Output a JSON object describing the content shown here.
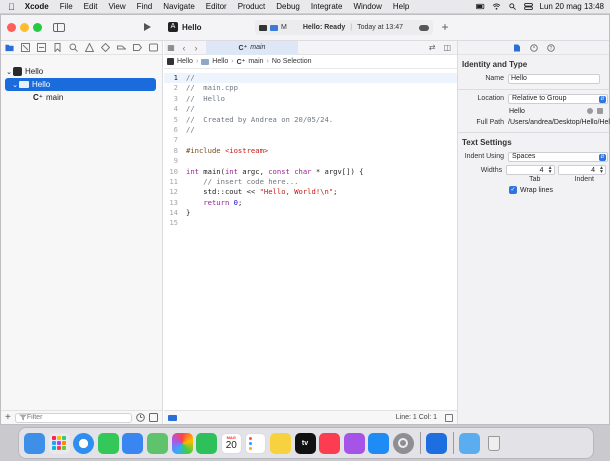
{
  "menubar": {
    "items": [
      "Xcode",
      "File",
      "Edit",
      "View",
      "Find",
      "Navigate",
      "Editor",
      "Product",
      "Debug",
      "Integrate",
      "Window",
      "Help"
    ],
    "clock": "Lun 20 mag  13:48"
  },
  "toolbar": {
    "project_title": "Hello",
    "status_device": "M",
    "status_text_bold": "Hello: Ready",
    "status_text_sep": "|",
    "status_time": "Today at 13:47"
  },
  "navigator": {
    "tree": {
      "project": "Hello",
      "group": "Hello",
      "file": "main",
      "file_prefix": "C⁺"
    },
    "filter_placeholder": "Filter"
  },
  "editor": {
    "tab": {
      "prefix": "C⁺",
      "label": "main"
    },
    "jumpbar": {
      "project": "Hello",
      "group": "Hello",
      "file_prefix": "C⁺",
      "file": "main",
      "selection": "No Selection"
    },
    "lines": [
      {
        "n": "1",
        "text": "//"
      },
      {
        "n": "2",
        "text": "//  main.cpp"
      },
      {
        "n": "3",
        "text": "//  Hello"
      },
      {
        "n": "4",
        "text": "//"
      },
      {
        "n": "5",
        "text": "//  Created by Andrea on 20/05/24."
      },
      {
        "n": "6",
        "text": "//"
      },
      {
        "n": "7",
        "text": ""
      },
      {
        "n": "8",
        "text": "#include <iostream>"
      },
      {
        "n": "9",
        "text": ""
      },
      {
        "n": "10",
        "text": "int main(int argc, const char * argv[]) {"
      },
      {
        "n": "11",
        "text": "    // insert code here..."
      },
      {
        "n": "12",
        "text": "    std::cout << \"Hello, World!\\n\";"
      },
      {
        "n": "13",
        "text": "    return 0;"
      },
      {
        "n": "14",
        "text": "}"
      },
      {
        "n": "15",
        "text": ""
      }
    ],
    "code_tokens": {
      "l8_directive": "#include ",
      "l8_header": "<iostream>",
      "l10_kw1": "int",
      "l10_t1": " main(",
      "l10_kw2": "int",
      "l10_t2": " argc, ",
      "l10_kw3": "const",
      "l10_t3": " ",
      "l10_kw4": "char",
      "l10_t4": " * argv[]) {",
      "l11": "    // insert code here...",
      "l12_t1": "    std::cout << ",
      "l12_str": "\"Hello, World!\\n\"",
      "l12_t2": ";",
      "l13_ind": "    ",
      "l13_kw": "return",
      "l13_sp": " ",
      "l13_num": "0",
      "l13_t": ";",
      "l14": "}"
    },
    "status": {
      "cursor": "Line: 1  Col: 1"
    }
  },
  "inspector": {
    "identity_title": "Identity and Type",
    "name_label": "Name",
    "name_value": "Hello",
    "location_label": "Location",
    "location_value": "Relative to Group",
    "location_path": "Hello",
    "full_path_label": "Full Path",
    "full_path_value": "/Users/andrea/Desktop/Hello/Hello",
    "text_settings_title": "Text Settings",
    "indent_using_label": "Indent Using",
    "indent_using_value": "Spaces",
    "widths_label": "Widths",
    "tab_width": "4",
    "indent_width": "4",
    "tab_caption": "Tab",
    "indent_caption": "Indent",
    "wrap_lines_label": "Wrap lines"
  },
  "dock": {
    "calendar_month": "MAG",
    "calendar_day": "20",
    "apple_tv_label": "tv",
    "icons": [
      {
        "name": "finder-icon",
        "color": "#3d8fe8"
      },
      {
        "name": "launchpad-icon",
        "color": "#e8e8ee"
      },
      {
        "name": "safari-icon",
        "color": "#2f8ef0"
      },
      {
        "name": "messages-icon",
        "color": "#34c759"
      },
      {
        "name": "mail-icon",
        "color": "#3a86f0"
      },
      {
        "name": "maps-icon",
        "color": "#5ec36a"
      },
      {
        "name": "photos-icon",
        "color": "#f5f5f5"
      },
      {
        "name": "facetime-icon",
        "color": "#2ec15b"
      },
      {
        "name": "calendar-icon",
        "color": "#ffffff"
      },
      {
        "name": "reminders-icon",
        "color": "#ffffff"
      },
      {
        "name": "notes-icon",
        "color": "#f7d23e"
      },
      {
        "name": "appletv-icon",
        "color": "#111111"
      },
      {
        "name": "music-icon",
        "color": "#fb3c51"
      },
      {
        "name": "podcasts-icon",
        "color": "#a654e8"
      },
      {
        "name": "appstore-icon",
        "color": "#1f8cf5"
      },
      {
        "name": "system-settings-icon",
        "color": "#8e8e93"
      },
      {
        "name": "xcode-icon",
        "color": "#1d6fe0"
      },
      {
        "name": "downloads-folder-icon",
        "color": "#5aaef0"
      },
      {
        "name": "trash-icon",
        "color": "#d8d8dd"
      }
    ]
  }
}
